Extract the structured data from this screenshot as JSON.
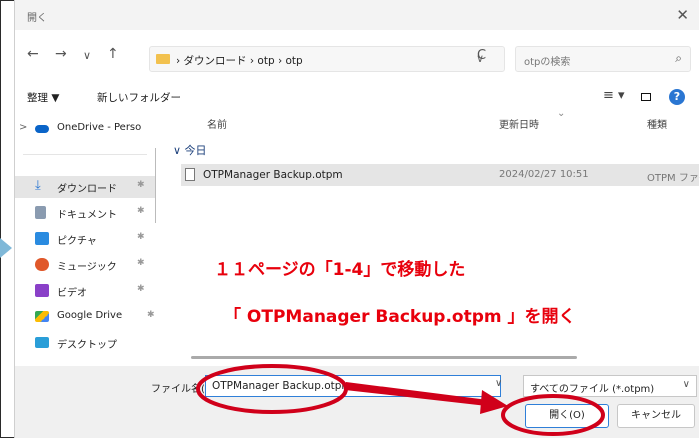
{
  "window": {
    "title": "開く",
    "close_glyph": "✕"
  },
  "nav": {
    "back": "←",
    "forward": "→",
    "recent": "∨",
    "up": "↑",
    "breadcrumb": "› ダウンロード › otp › otp",
    "refresh": "C",
    "search_placeholder": "otpの検索",
    "search_icon": "search-icon"
  },
  "toolbar": {
    "organize": "整理 ▼",
    "new_folder": "新しいフォルダー",
    "view": "≡ ▾",
    "help": "?"
  },
  "sidebar": {
    "items": [
      {
        "label": "OneDrive - Perso",
        "icon": "onedrive-icon",
        "color": "#0a64c8",
        "pinned": false,
        "expand": ">"
      },
      {
        "label": "ダウンロード",
        "icon": "download-icon",
        "color": "#2a76d2",
        "pinned": true,
        "selected": true
      },
      {
        "label": "ドキュメント",
        "icon": "document-icon",
        "color": "#8a9bb0",
        "pinned": true
      },
      {
        "label": "ピクチャ",
        "icon": "pictures-icon",
        "color": "#2a8be0",
        "pinned": true
      },
      {
        "label": "ミュージック",
        "icon": "music-icon",
        "color": "#e0582a",
        "pinned": true
      },
      {
        "label": "ビデオ",
        "icon": "video-icon",
        "color": "#8a40c8",
        "pinned": true
      },
      {
        "label": "Google Drive",
        "icon": "google-drive-icon",
        "color": "#34a853",
        "pinned": true
      },
      {
        "label": "デスクトップ",
        "icon": "desktop-icon",
        "color": "#2a9ed8",
        "pinned": false
      }
    ],
    "pin_glyph": "✱"
  },
  "filelist": {
    "columns": [
      "名前",
      "更新日時",
      "種類"
    ],
    "group": "∨ 今日",
    "rows": [
      {
        "name": "OTPManager Backup.otpm",
        "date": "2024/02/27 10:51",
        "type": "OTPM ファイ"
      }
    ]
  },
  "bottom": {
    "filename_label": "ファイル名(N):",
    "filename_value": "OTPManager Backup.otpm",
    "filetype": "すべてのファイル (*.otpm)",
    "open_button": "開く(O)",
    "cancel_button": "キャンセル"
  },
  "annotation": {
    "line1": "１１ページの「1-4」で移動した",
    "line2": "「 OTPManager Backup.otpm 」を開く",
    "color": "#e8000c"
  }
}
